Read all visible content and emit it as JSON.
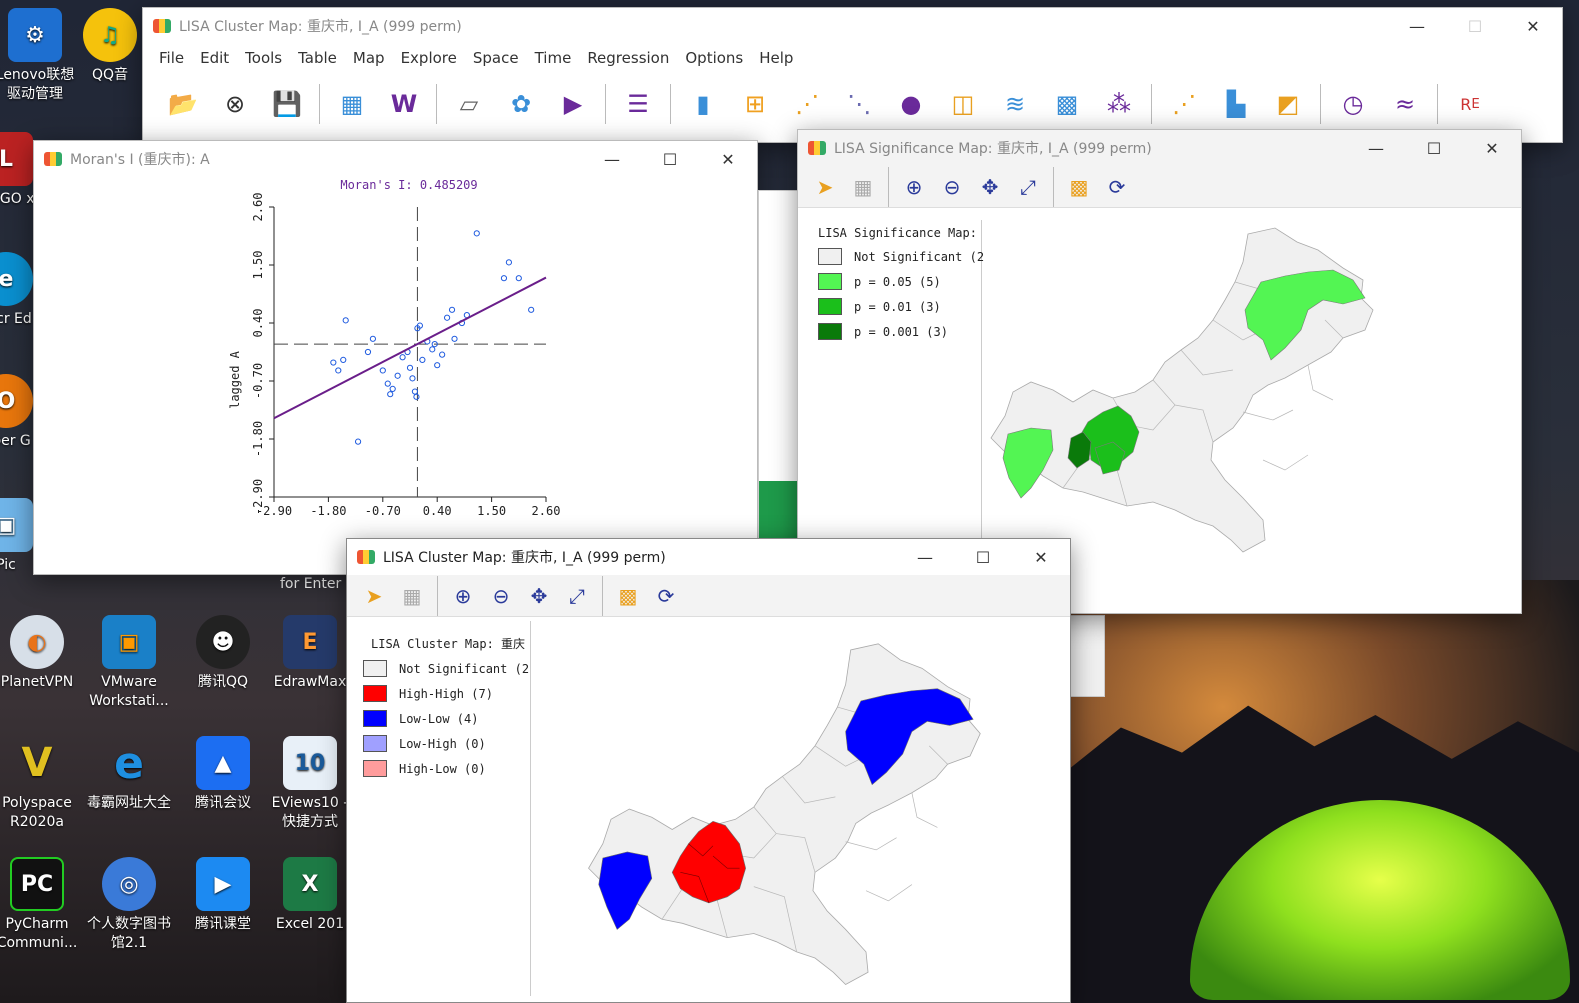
{
  "desktop": {
    "left_icons_top": [
      "Lenovo联想驱动管理",
      "QQ音",
      "LINGO x",
      "Micr Ed",
      "Oper G",
      "Pic"
    ],
    "icons": [
      {
        "label": "PlanetVPN"
      },
      {
        "label": "VMware Workstati..."
      },
      {
        "label": "腾讯QQ"
      },
      {
        "label": "EdrawMax"
      },
      {
        "label": "Polyspace R2020a"
      },
      {
        "label": "毒霸网址大全"
      },
      {
        "label": "腾讯会议"
      },
      {
        "label": "EViews10 - 快捷方式"
      },
      {
        "label": "PyCharm Communi..."
      },
      {
        "label": "个人数字图书馆2.1"
      },
      {
        "label": "腾讯课堂"
      },
      {
        "label": "Excel 201"
      }
    ],
    "partial_text": "for Enter"
  },
  "main_window": {
    "title": "LISA Cluster Map: 重庆市, I_A (999 perm)",
    "menu": [
      "File",
      "Edit",
      "Tools",
      "Table",
      "Map",
      "Explore",
      "Space",
      "Time",
      "Regression",
      "Options",
      "Help"
    ]
  },
  "moran_window": {
    "title": "Moran's I (重庆市): A",
    "chart_label": "Moran's I: 0.485209",
    "x_axis_label": "A",
    "y_axis_label": "lagged A"
  },
  "chart_data": {
    "type": "scatter",
    "title": "Moran's I: 0.485209",
    "xlabel": "A",
    "ylabel": "lagged A",
    "xlim": [
      -2.9,
      2.6
    ],
    "ylim": [
      -2.9,
      2.6
    ],
    "x_ticks": [
      "-2.90",
      "-1.80",
      "-0.70",
      "0.40",
      "1.50",
      "2.60"
    ],
    "y_ticks": [
      "-2.90",
      "-1.80",
      "-0.70",
      "0.40",
      "1.50",
      "2.60"
    ],
    "slope": 0.485209,
    "points": [
      [
        1.2,
        2.1
      ],
      [
        1.85,
        1.55
      ],
      [
        1.75,
        1.25
      ],
      [
        2.05,
        1.25
      ],
      [
        2.3,
        0.65
      ],
      [
        -1.45,
        0.45
      ],
      [
        -1.7,
        -0.35
      ],
      [
        -1.5,
        -0.3
      ],
      [
        -1.6,
        -0.5
      ],
      [
        -1.0,
        -0.15
      ],
      [
        -0.9,
        0.1
      ],
      [
        -0.7,
        -0.5
      ],
      [
        -0.6,
        -0.75
      ],
      [
        -0.5,
        -0.85
      ],
      [
        -0.55,
        -0.95
      ],
      [
        -0.3,
        -0.25
      ],
      [
        -0.2,
        -0.15
      ],
      [
        -0.15,
        -0.45
      ],
      [
        -0.1,
        -0.65
      ],
      [
        -0.05,
        -0.9
      ],
      [
        -0.02,
        -1.0
      ],
      [
        0.0,
        0.3
      ],
      [
        0.05,
        0.35
      ],
      [
        0.1,
        -0.3
      ],
      [
        0.35,
        0.0
      ],
      [
        0.3,
        -0.1
      ],
      [
        0.4,
        -0.4
      ],
      [
        0.5,
        -0.2
      ],
      [
        0.6,
        0.5
      ],
      [
        0.7,
        0.65
      ],
      [
        0.75,
        0.1
      ],
      [
        0.9,
        0.4
      ],
      [
        1.0,
        0.55
      ],
      [
        -1.2,
        -1.85
      ],
      [
        -0.4,
        -0.6
      ],
      [
        0.2,
        0.05
      ]
    ]
  },
  "significance_window": {
    "title": "LISA Significance Map: 重庆市, I_A (999 perm)",
    "legend_title": "LISA Significance Map:",
    "legend": [
      {
        "label": "Not Significant (2",
        "color": "#f0f0f0"
      },
      {
        "label": "p = 0.05 (5)",
        "color": "#53f553"
      },
      {
        "label": "p = 0.01 (3)",
        "color": "#1bbf1b"
      },
      {
        "label": "p = 0.001 (3)",
        "color": "#0a7a0a"
      }
    ]
  },
  "cluster_window": {
    "title": "LISA Cluster Map: 重庆市, I_A (999 perm)",
    "legend_title": "LISA Cluster Map: 重庆",
    "legend": [
      {
        "label": "Not Significant (2",
        "color": "#f0f0f0"
      },
      {
        "label": "High-High (7)",
        "color": "#ff0000"
      },
      {
        "label": "Low-Low (4)",
        "color": "#0000ff"
      },
      {
        "label": "Low-High (0)",
        "color": "#a0a0ff"
      },
      {
        "label": "High-Low (0)",
        "color": "#ff9c9c"
      }
    ]
  }
}
